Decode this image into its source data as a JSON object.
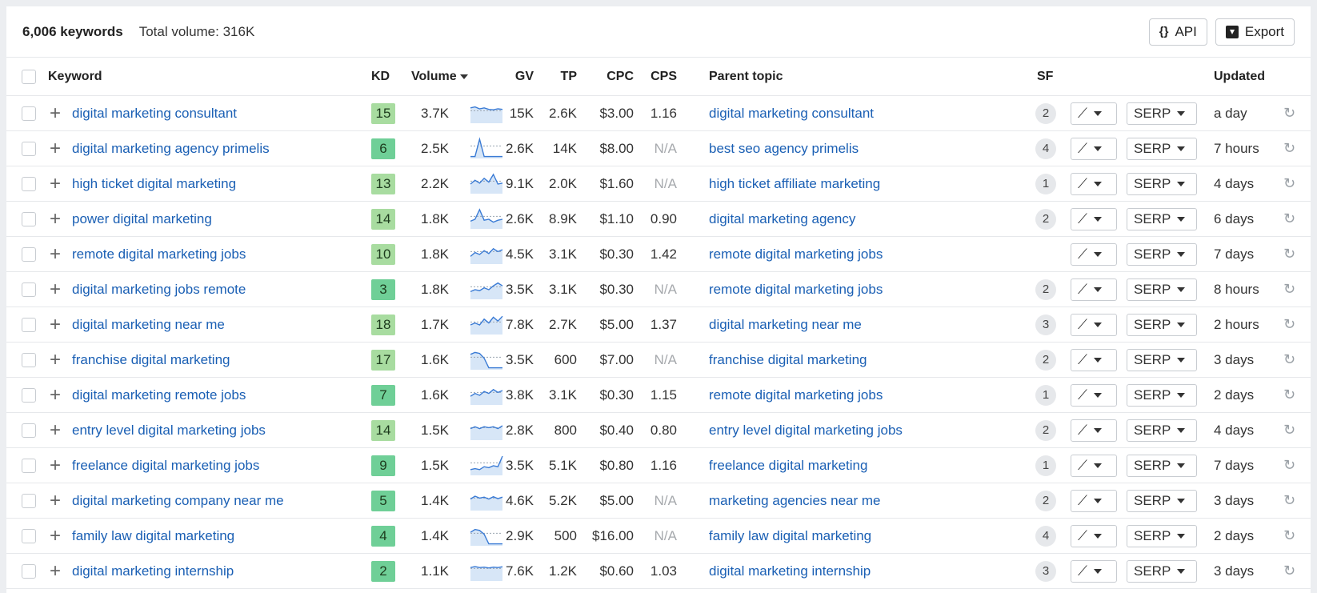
{
  "header": {
    "keyword_count": "6,006 keywords",
    "total_volume": "Total volume: 316K",
    "api_icon": "{}",
    "api_label": "API",
    "export_label": "Export"
  },
  "columns": {
    "keyword": "Keyword",
    "kd": "KD",
    "volume": "Volume",
    "gv": "GV",
    "tp": "TP",
    "cpc": "CPC",
    "cps": "CPS",
    "parent_topic": "Parent topic",
    "sf": "SF",
    "updated": "Updated"
  },
  "serp_label": "SERP",
  "kd_colors": {
    "low": "#6fcf97",
    "mid": "#a8dca0"
  },
  "rows": [
    {
      "keyword": "digital marketing consultant",
      "kd": "15",
      "volume": "3.7K",
      "gv": "15K",
      "tp": "2.6K",
      "cpc": "$3.00",
      "cps": "1.16",
      "parent": "digital marketing consultant",
      "sf": "2",
      "updated": "a day",
      "trend": [
        0.8,
        0.85,
        0.75,
        0.8,
        0.72,
        0.7,
        0.75,
        0.72
      ]
    },
    {
      "keyword": "digital marketing agency primelis",
      "kd": "6",
      "volume": "2.5K",
      "gv": "2.6K",
      "tp": "14K",
      "cpc": "$8.00",
      "cps": "N/A",
      "parent": "best seo agency primelis",
      "sf": "4",
      "updated": "7 hours",
      "trend": [
        0.1,
        0.1,
        1.0,
        0.1,
        0.1,
        0.1,
        0.1,
        0.1
      ]
    },
    {
      "keyword": "high ticket digital marketing",
      "kd": "13",
      "volume": "2.2K",
      "gv": "9.1K",
      "tp": "2.0K",
      "cpc": "$1.60",
      "cps": "N/A",
      "parent": "high ticket affiliate marketing",
      "sf": "1",
      "updated": "4 days",
      "trend": [
        0.5,
        0.7,
        0.55,
        0.8,
        0.6,
        1.0,
        0.5,
        0.55
      ]
    },
    {
      "keyword": "power digital marketing",
      "kd": "14",
      "volume": "1.8K",
      "gv": "2.6K",
      "tp": "8.9K",
      "cpc": "$1.10",
      "cps": "0.90",
      "parent": "digital marketing agency",
      "sf": "2",
      "updated": "6 days",
      "trend": [
        0.4,
        0.5,
        1.0,
        0.45,
        0.5,
        0.35,
        0.45,
        0.5
      ]
    },
    {
      "keyword": "remote digital marketing jobs",
      "kd": "10",
      "volume": "1.8K",
      "gv": "4.5K",
      "tp": "3.1K",
      "cpc": "$0.30",
      "cps": "1.42",
      "parent": "remote digital marketing jobs",
      "sf": "",
      "updated": "7 days",
      "trend": [
        0.4,
        0.6,
        0.5,
        0.7,
        0.55,
        0.8,
        0.65,
        0.75
      ]
    },
    {
      "keyword": "digital marketing jobs remote",
      "kd": "3",
      "volume": "1.8K",
      "gv": "3.5K",
      "tp": "3.1K",
      "cpc": "$0.30",
      "cps": "N/A",
      "parent": "remote digital marketing jobs",
      "sf": "2",
      "updated": "8 hours",
      "trend": [
        0.4,
        0.5,
        0.45,
        0.6,
        0.5,
        0.7,
        0.85,
        0.7
      ]
    },
    {
      "keyword": "digital marketing near me",
      "kd": "18",
      "volume": "1.7K",
      "gv": "7.8K",
      "tp": "2.7K",
      "cpc": "$5.00",
      "cps": "1.37",
      "parent": "digital marketing near me",
      "sf": "3",
      "updated": "2 hours",
      "trend": [
        0.5,
        0.6,
        0.5,
        0.8,
        0.6,
        0.9,
        0.7,
        0.95
      ]
    },
    {
      "keyword": "franchise digital marketing",
      "kd": "17",
      "volume": "1.6K",
      "gv": "3.5K",
      "tp": "600",
      "cpc": "$7.00",
      "cps": "N/A",
      "parent": "franchise digital marketing",
      "sf": "2",
      "updated": "3 days",
      "trend": [
        0.8,
        0.9,
        0.85,
        0.6,
        0.1,
        0.1,
        0.1,
        0.1
      ]
    },
    {
      "keyword": "digital marketing remote jobs",
      "kd": "7",
      "volume": "1.6K",
      "gv": "3.8K",
      "tp": "3.1K",
      "cpc": "$0.30",
      "cps": "1.15",
      "parent": "remote digital marketing jobs",
      "sf": "1",
      "updated": "2 days",
      "trend": [
        0.45,
        0.6,
        0.5,
        0.7,
        0.6,
        0.8,
        0.65,
        0.75
      ]
    },
    {
      "keyword": "entry level digital marketing jobs",
      "kd": "14",
      "volume": "1.5K",
      "gv": "2.8K",
      "tp": "800",
      "cpc": "$0.40",
      "cps": "0.80",
      "parent": "entry level digital marketing jobs",
      "sf": "2",
      "updated": "4 days",
      "trend": [
        0.6,
        0.7,
        0.6,
        0.7,
        0.65,
        0.7,
        0.6,
        0.75
      ]
    },
    {
      "keyword": "freelance digital marketing jobs",
      "kd": "9",
      "volume": "1.5K",
      "gv": "3.5K",
      "tp": "5.1K",
      "cpc": "$0.80",
      "cps": "1.16",
      "parent": "freelance digital marketing",
      "sf": "1",
      "updated": "7 days",
      "trend": [
        0.3,
        0.35,
        0.3,
        0.45,
        0.4,
        0.5,
        0.45,
        1.0
      ]
    },
    {
      "keyword": "digital marketing company near me",
      "kd": "5",
      "volume": "1.4K",
      "gv": "4.6K",
      "tp": "5.2K",
      "cpc": "$5.00",
      "cps": "N/A",
      "parent": "marketing agencies near me",
      "sf": "2",
      "updated": "3 days",
      "trend": [
        0.6,
        0.75,
        0.65,
        0.7,
        0.6,
        0.72,
        0.62,
        0.7
      ]
    },
    {
      "keyword": "family law digital marketing",
      "kd": "4",
      "volume": "1.4K",
      "gv": "2.9K",
      "tp": "500",
      "cpc": "$16.00",
      "cps": "N/A",
      "parent": "family law digital marketing",
      "sf": "4",
      "updated": "2 days",
      "trend": [
        0.7,
        0.85,
        0.8,
        0.6,
        0.1,
        0.1,
        0.1,
        0.1
      ]
    },
    {
      "keyword": "digital marketing internship",
      "kd": "2",
      "volume": "1.1K",
      "gv": "7.6K",
      "tp": "1.2K",
      "cpc": "$0.60",
      "cps": "1.03",
      "parent": "digital marketing internship",
      "sf": "3",
      "updated": "3 days",
      "trend": [
        0.7,
        0.75,
        0.7,
        0.72,
        0.68,
        0.72,
        0.7,
        0.74
      ]
    }
  ]
}
